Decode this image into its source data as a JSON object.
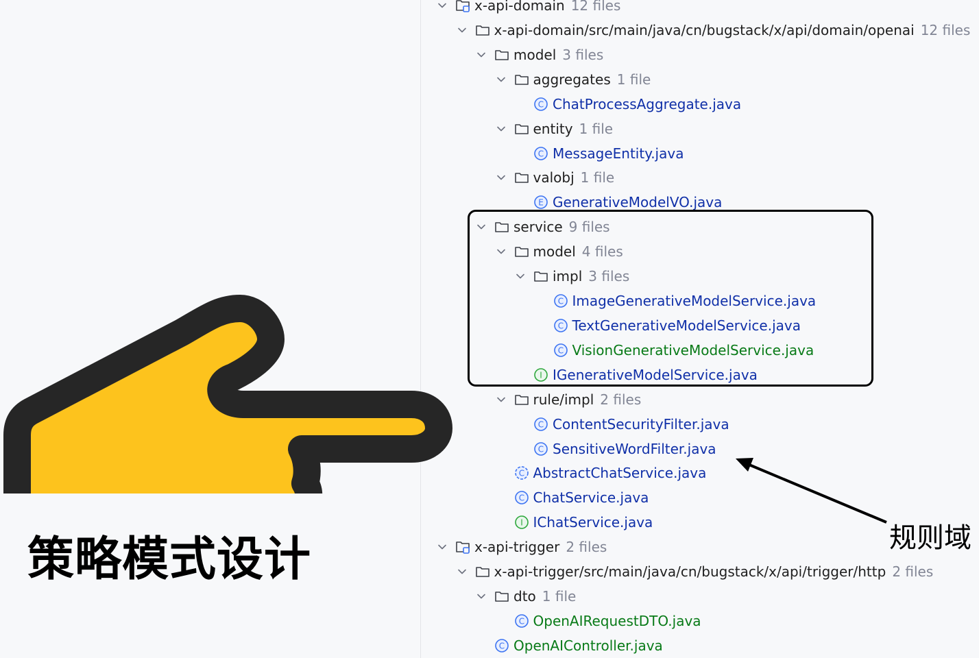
{
  "caption": "策略模式设计",
  "annotation": "规则域",
  "colors": {
    "class_blue": "#1030a8",
    "vcs_green": "#087a17",
    "count_gray": "#818594",
    "hand_yellow": "#fdc31d",
    "hand_outline": "#262626"
  },
  "tree": [
    {
      "depth": 0,
      "chevron": true,
      "icon": "module-folder-icon",
      "label": "x-api-domain",
      "count": "12 files"
    },
    {
      "depth": 1,
      "chevron": true,
      "icon": "folder-icon",
      "label": "x-api-domain/src/main/java/cn/bugstack/x/api/domain/openai",
      "count": "12 files"
    },
    {
      "depth": 2,
      "chevron": true,
      "icon": "folder-icon",
      "label": "model",
      "count": "3 files"
    },
    {
      "depth": 3,
      "chevron": true,
      "icon": "folder-icon",
      "label": "aggregates",
      "count": "1 file"
    },
    {
      "depth": 4,
      "chevron": false,
      "icon": "class-icon",
      "label": "ChatProcessAggregate.java",
      "count": "",
      "color": "blue"
    },
    {
      "depth": 3,
      "chevron": true,
      "icon": "folder-icon",
      "label": "entity",
      "count": "1 file"
    },
    {
      "depth": 4,
      "chevron": false,
      "icon": "class-icon",
      "label": "MessageEntity.java",
      "count": "",
      "color": "blue"
    },
    {
      "depth": 3,
      "chevron": true,
      "icon": "folder-icon",
      "label": "valobj",
      "count": "1 file"
    },
    {
      "depth": 4,
      "chevron": false,
      "icon": "enum-icon",
      "label": "GenerativeModelVO.java",
      "count": "",
      "color": "blue"
    },
    {
      "depth": 2,
      "chevron": true,
      "icon": "folder-icon",
      "label": "service",
      "count": "9 files"
    },
    {
      "depth": 3,
      "chevron": true,
      "icon": "folder-icon",
      "label": "model",
      "count": "4 files"
    },
    {
      "depth": 4,
      "chevron": true,
      "icon": "folder-icon",
      "label": "impl",
      "count": "3 files"
    },
    {
      "depth": 5,
      "chevron": false,
      "icon": "class-icon",
      "label": "ImageGenerativeModelService.java",
      "count": "",
      "color": "blue"
    },
    {
      "depth": 5,
      "chevron": false,
      "icon": "class-icon",
      "label": "TextGenerativeModelService.java",
      "count": "",
      "color": "blue"
    },
    {
      "depth": 5,
      "chevron": false,
      "icon": "class-icon",
      "label": "VisionGenerativeModelService.java",
      "count": "",
      "color": "green"
    },
    {
      "depth": 4,
      "chevron": false,
      "icon": "interface-icon",
      "label": "IGenerativeModelService.java",
      "count": "",
      "color": "blue"
    },
    {
      "depth": 3,
      "chevron": true,
      "icon": "folder-icon",
      "label": "rule/impl",
      "count": "2 files"
    },
    {
      "depth": 4,
      "chevron": false,
      "icon": "class-icon",
      "label": "ContentSecurityFilter.java",
      "count": "",
      "color": "blue"
    },
    {
      "depth": 4,
      "chevron": false,
      "icon": "class-icon",
      "label": "SensitiveWordFilter.java",
      "count": "",
      "color": "blue"
    },
    {
      "depth": 3,
      "chevron": false,
      "icon": "abstract-class-icon",
      "label": "AbstractChatService.java",
      "count": "",
      "color": "blue"
    },
    {
      "depth": 3,
      "chevron": false,
      "icon": "class-icon",
      "label": "ChatService.java",
      "count": "",
      "color": "blue"
    },
    {
      "depth": 3,
      "chevron": false,
      "icon": "interface-icon",
      "label": "IChatService.java",
      "count": "",
      "color": "blue"
    },
    {
      "depth": 0,
      "chevron": true,
      "icon": "module-folder-icon",
      "label": "x-api-trigger",
      "count": "2 files"
    },
    {
      "depth": 1,
      "chevron": true,
      "icon": "folder-icon",
      "label": "x-api-trigger/src/main/java/cn/bugstack/x/api/trigger/http",
      "count": "2 files"
    },
    {
      "depth": 2,
      "chevron": true,
      "icon": "folder-icon",
      "label": "dto",
      "count": "1 file"
    },
    {
      "depth": 3,
      "chevron": false,
      "icon": "class-icon",
      "label": "OpenAIRequestDTO.java",
      "count": "",
      "color": "green"
    },
    {
      "depth": 2,
      "chevron": false,
      "icon": "class-icon",
      "label": "OpenAIController.java",
      "count": "",
      "color": "green"
    }
  ]
}
